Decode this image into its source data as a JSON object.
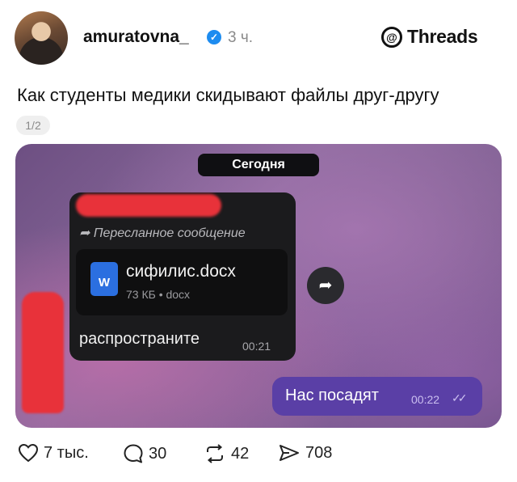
{
  "post": {
    "username": "amuratovna_",
    "time": "3 ч.",
    "brand": "Threads",
    "text": "Как студенты медики скидывают файлы друг-другу",
    "pager": "1/2"
  },
  "chat": {
    "date": "Сегодня",
    "incoming": {
      "forwarded_label": "Пересланное сообщение",
      "file_name": "сифилис.docx",
      "file_meta": "73 КБ • docx",
      "file_icon_letter": "W",
      "text": "распространите",
      "time": "00:21"
    },
    "outgoing": {
      "text": "Нас посадят",
      "time": "00:22",
      "status": "read"
    }
  },
  "actions": {
    "likes": "7 тыс.",
    "replies": "30",
    "reposts": "42",
    "shares": "708"
  },
  "colors": {
    "verified": "#1d8cf0",
    "outgoing_bubble": "#5a3fa6",
    "incoming_bubble": "#1b1b1d"
  }
}
